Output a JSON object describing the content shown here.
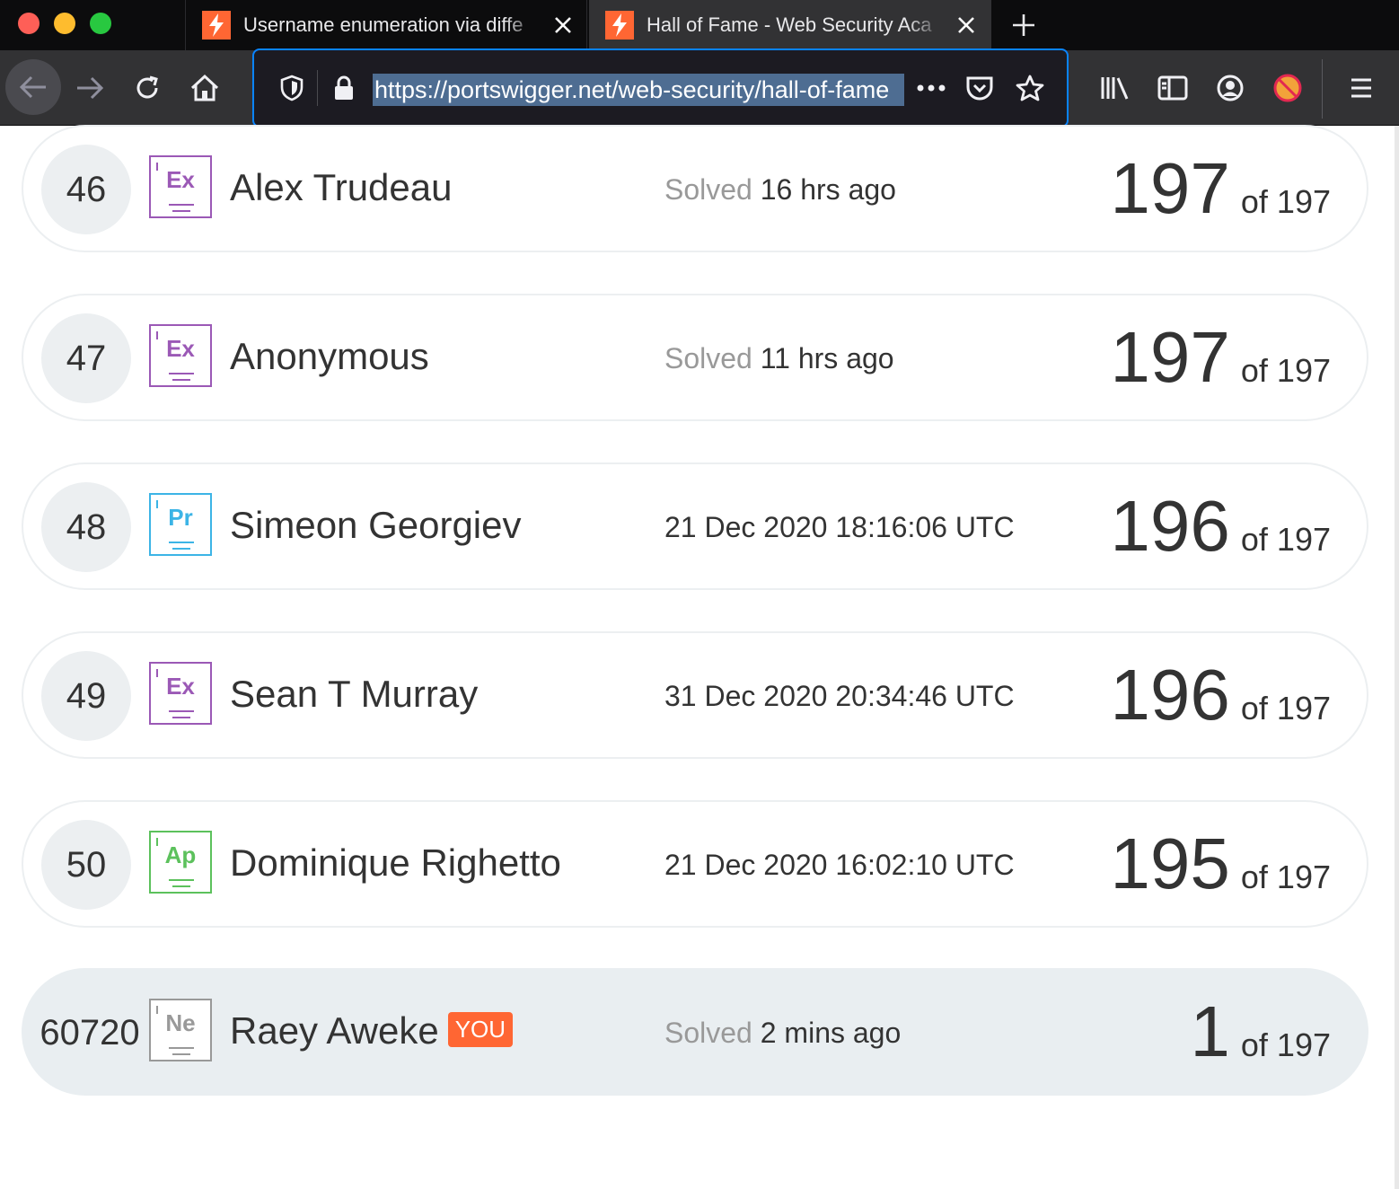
{
  "browser": {
    "tabs": [
      {
        "title": "Username enumeration via diffe",
        "active": false
      },
      {
        "title": "Hall of Fame - Web Security Aca",
        "active": true
      }
    ],
    "url": "https://portswigger.net/web-security/hall-of-fame",
    "colors": {
      "tab_bar": "#0c0c0d",
      "toolbar": "#323234",
      "url_focus": "#0a84ff",
      "favicon": "#ff6633"
    }
  },
  "leaderboard": {
    "solved_label": "Solved",
    "of_label": "of 197",
    "you_label": "YOU",
    "rows": [
      {
        "rank": "46",
        "badge": "Ex",
        "badge_color": "#9b59b6",
        "name": "Alex Trudeau",
        "solved_prefix": "Solved",
        "solved_value": "16 hrs ago",
        "score": "197",
        "of": "of 197"
      },
      {
        "rank": "47",
        "badge": "Ex",
        "badge_color": "#9b59b6",
        "name": "Anonymous",
        "solved_prefix": "Solved",
        "solved_value": "11 hrs ago",
        "score": "197",
        "of": "of 197"
      },
      {
        "rank": "48",
        "badge": "Pr",
        "badge_color": "#3cb4e6",
        "name": "Simeon Georgiev",
        "solved_prefix": "",
        "solved_value": "21 Dec 2020 18:16:06 UTC",
        "score": "196",
        "of": "of 197"
      },
      {
        "rank": "49",
        "badge": "Ex",
        "badge_color": "#9b59b6",
        "name": "Sean T Murray",
        "solved_prefix": "",
        "solved_value": "31 Dec 2020 20:34:46 UTC",
        "score": "196",
        "of": "of 197"
      },
      {
        "rank": "50",
        "badge": "Ap",
        "badge_color": "#5cc15c",
        "name": "Dominique Righetto",
        "solved_prefix": "",
        "solved_value": "21 Dec 2020 16:02:10 UTC",
        "score": "195",
        "of": "of 197"
      },
      {
        "rank": "60720",
        "badge": "Ne",
        "badge_color": "#999999",
        "name": "Raey Aweke",
        "solved_prefix": "Solved",
        "solved_value": "2 mins ago",
        "score": "1",
        "of": "of 197",
        "is_you": true
      }
    ]
  }
}
